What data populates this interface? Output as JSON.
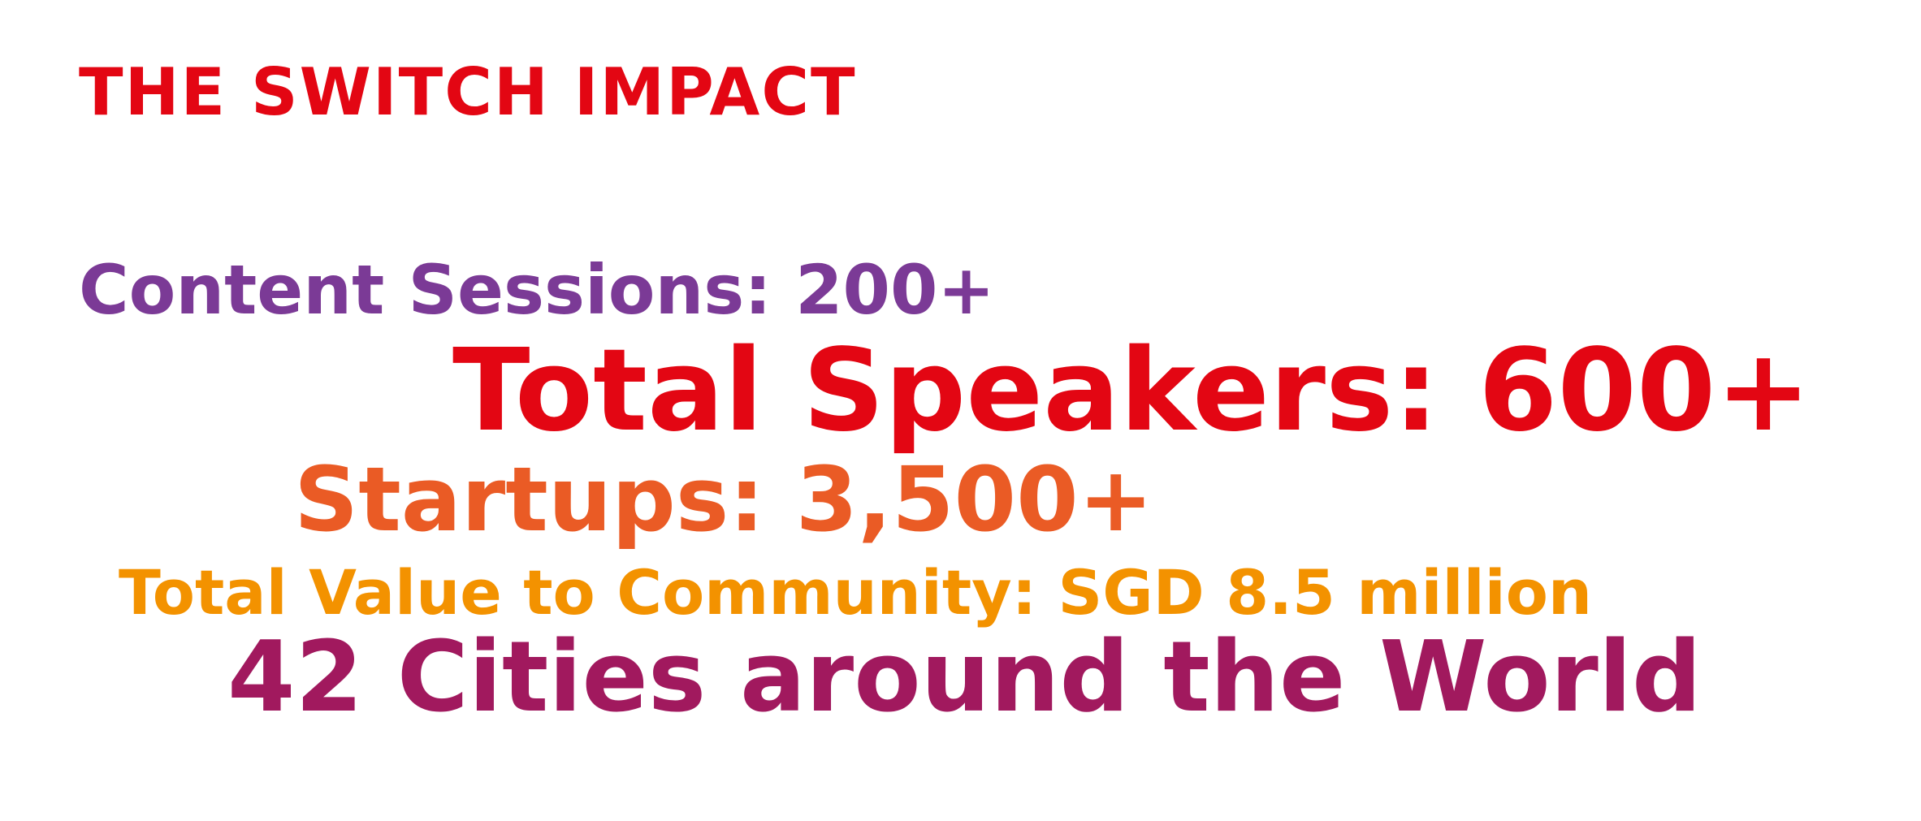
{
  "slide": {
    "title": "THE SWITCH IMPACT",
    "stats": {
      "content_sessions": "Content Sessions: 200+",
      "total_speakers": "Total Speakers: 600+",
      "startups": "Startups: 3,500+",
      "total_value": "Total Value to Community: SGD 8.5 million",
      "cities": "42 Cities around the World"
    },
    "colors": {
      "red": "#e30613",
      "purple": "#7b3a96",
      "orange": "#ea5b25",
      "amber": "#f39200",
      "magenta": "#a1195e"
    }
  }
}
